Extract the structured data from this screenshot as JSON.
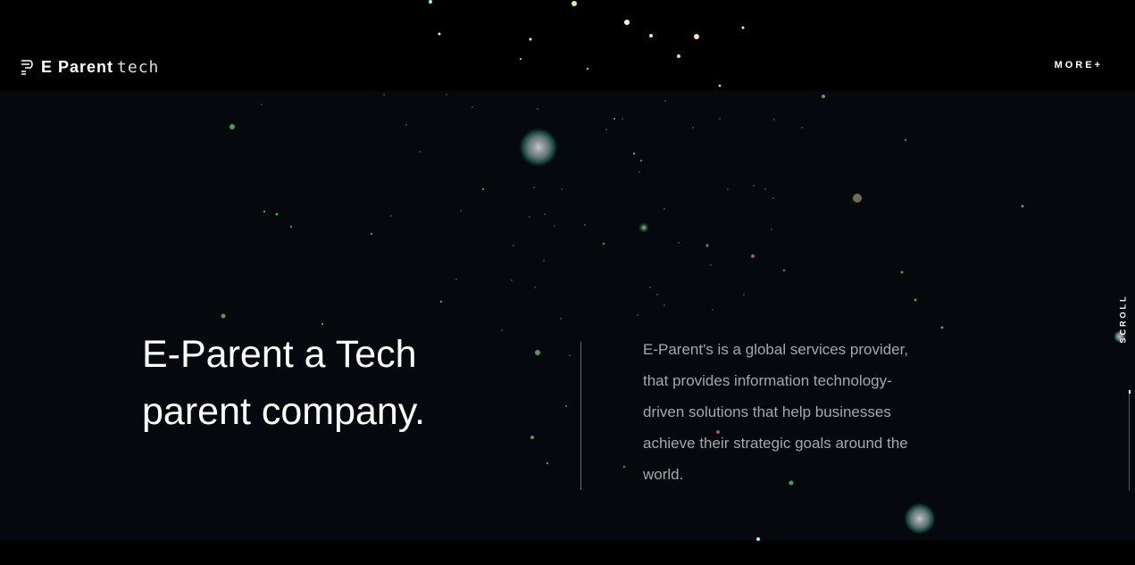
{
  "header": {
    "logo_text": "E Parent",
    "logo_tech": "tech",
    "more_label": "MORE+"
  },
  "hero": {
    "headline_line1": "E-Parent a Tech",
    "headline_line2": "parent company.",
    "description": "E-Parent's is a global services provider, that provides information technology-driven solutions that help businesses achieve their strategic goals around the world."
  },
  "scroll_label": "SCROLL",
  "colors": {
    "background": "#000000",
    "hero_background": "#05080d",
    "text": "#ffffff",
    "muted_text": "#a5a8ad",
    "particle_green": "#5fbf7a",
    "particle_teal": "#49b39a"
  },
  "icons": {
    "logo": "e-parent-logo-icon"
  }
}
